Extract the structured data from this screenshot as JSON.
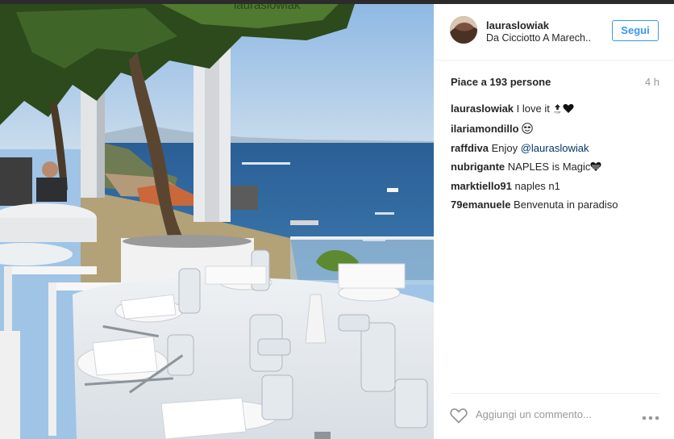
{
  "post": {
    "image_alt": "Seaside restaurant terrace with set tables overlooking the sea",
    "overlay_text": "laurasiowiak"
  },
  "header": {
    "username": "lauraslowiak",
    "location": "Da Cicciotto A Marech..",
    "follow_label": "Segui"
  },
  "stats": {
    "likes": "Piace a 193 persone",
    "time_ago": "4 h"
  },
  "comments": [
    {
      "user": "lauraslowiak",
      "text": " I love it ",
      "emoji": [
        "top-icon",
        "black-heart-icon"
      ]
    },
    {
      "user": "ilariamondillo",
      "text": " ",
      "emoji": [
        "smiling-face-sunglasses-icon"
      ]
    },
    {
      "user": "raffdiva",
      "text": " Enjoy ",
      "mention": "@lauraslowiak"
    },
    {
      "user": "nubrigante",
      "text": " NAPLES is Magic",
      "emoji": [
        "heart-icon"
      ]
    },
    {
      "user": "marktiello91",
      "text": " naples n1"
    },
    {
      "user": "79emanuele",
      "text": " Benvenuta in paradiso"
    }
  ],
  "footer": {
    "comment_placeholder": "Aggiungi un commento..."
  },
  "icons": {
    "like": "heart-outline-icon",
    "more": "more-options-icon"
  },
  "colors": {
    "follow_blue": "#3897f0",
    "mention_blue": "#003569",
    "muted_text": "#999999"
  }
}
